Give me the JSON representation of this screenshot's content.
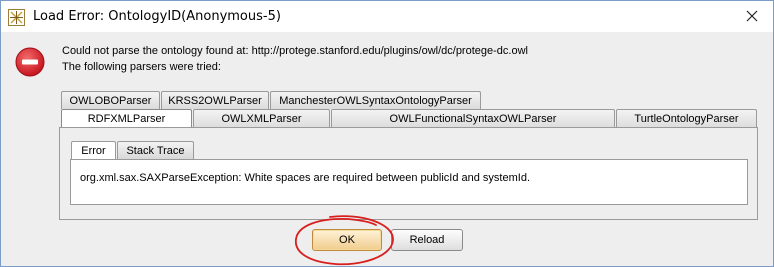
{
  "window": {
    "title": "Load Error: OntologyID(Anonymous-5)"
  },
  "message": {
    "line1": "Could not parse the ontology found at: http://protege.stanford.edu/plugins/owl/dc/protege-dc.owl",
    "line2": "The following parsers were tried:"
  },
  "parser_tabs": {
    "row1": [
      {
        "label": "OWLOBOParser"
      },
      {
        "label": "KRSS2OWLParser"
      },
      {
        "label": "ManchesterOWLSyntaxOntologyParser"
      }
    ],
    "row2": [
      {
        "label": "RDFXMLParser",
        "selected": true
      },
      {
        "label": "OWLXMLParser"
      },
      {
        "label": "OWLFunctionalSyntaxOWLParser"
      },
      {
        "label": "TurtleOntologyParser"
      }
    ]
  },
  "detail_tabs": [
    {
      "label": "Error",
      "selected": true
    },
    {
      "label": "Stack Trace"
    }
  ],
  "error_text": "org.xml.sax.SAXParseException: White spaces are required between publicId and systemId.",
  "buttons": {
    "ok": "OK",
    "reload": "Reload"
  },
  "colors": {
    "error_icon": "#d4202c",
    "annotation_circle": "#d81e1e",
    "ok_button": "#f0cc8c"
  },
  "icons": [
    "app-icon",
    "close-icon",
    "error-icon"
  ]
}
